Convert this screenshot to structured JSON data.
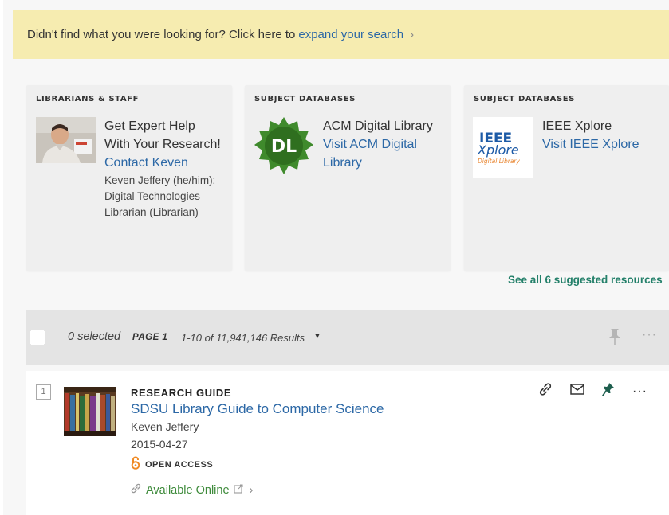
{
  "banner": {
    "text": "Didn't find what you were looking for? Click here to",
    "link": "expand your search"
  },
  "cards": [
    {
      "category": "LIBRARIANS & STAFF",
      "title": "Get Expert Help With Your Research!",
      "link": "Contact Keven",
      "description": "Keven Jeffery (he/him): Digital Technologies Librarian (Librarian)"
    },
    {
      "category": "SUBJECT DATABASES",
      "title": "ACM Digital Library",
      "link": "Visit ACM Digital Library",
      "logo_text": "DL"
    },
    {
      "category": "SUBJECT DATABASES",
      "title": "IEEE Xplore",
      "link": "Visit IEEE Xplore",
      "logo_line1": "IEEE",
      "logo_line2": "Xplore",
      "logo_line3": "Digital Library"
    }
  ],
  "see_all": "See all 6 suggested resources",
  "toolbar": {
    "selected": "0 selected",
    "page": "PAGE 1",
    "results": "1-10 of 11,941,146 Results",
    "more": "···"
  },
  "result": {
    "number": "1",
    "type": "RESEARCH GUIDE",
    "title": "SDSU Library Guide to Computer Science",
    "author": "Keven Jeffery",
    "date": "2015-04-27",
    "access": "OPEN ACCESS",
    "availability": "Available Online",
    "more": "···"
  },
  "colors": {
    "banner_bg": "#f6ecb0",
    "link": "#2c68a6",
    "see_all": "#24806a",
    "available": "#3d8a3a",
    "open_access": "#f08a24",
    "pin_active": "#1e5e4e"
  }
}
